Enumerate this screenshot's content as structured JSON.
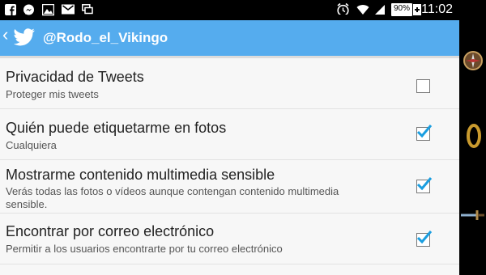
{
  "status_bar": {
    "time": "11:02",
    "battery": "90%",
    "icons": [
      "facebook-icon",
      "messenger-icon",
      "gallery-icon",
      "gmail-icon",
      "screen-icon",
      "alarm-icon",
      "wifi-icon",
      "signal-icon",
      "battery-icon",
      "charging-icon"
    ]
  },
  "action_bar": {
    "account": "@Rodo_el_Vikingo",
    "color": "#55acee"
  },
  "settings": [
    {
      "title": "Privacidad de Tweets",
      "subtitle": "Proteger mis tweets",
      "checked": false
    },
    {
      "title": "Quién puede etiquetarme en fotos",
      "subtitle": "Cualquiera",
      "checked": true
    },
    {
      "title": "Mostrarme contenido multimedia sensible",
      "subtitle": "Verás todas las fotos o vídeos aunque contengan contenido multimedia sensible.",
      "checked": true
    },
    {
      "title": "Encontrar por correo electrónico",
      "subtitle": "Permitir a los usuarios encontrarte por tu correo electrónico",
      "checked": true
    }
  ],
  "side_icons": [
    "compass-icon",
    "ring-icon",
    "sword-icon"
  ]
}
